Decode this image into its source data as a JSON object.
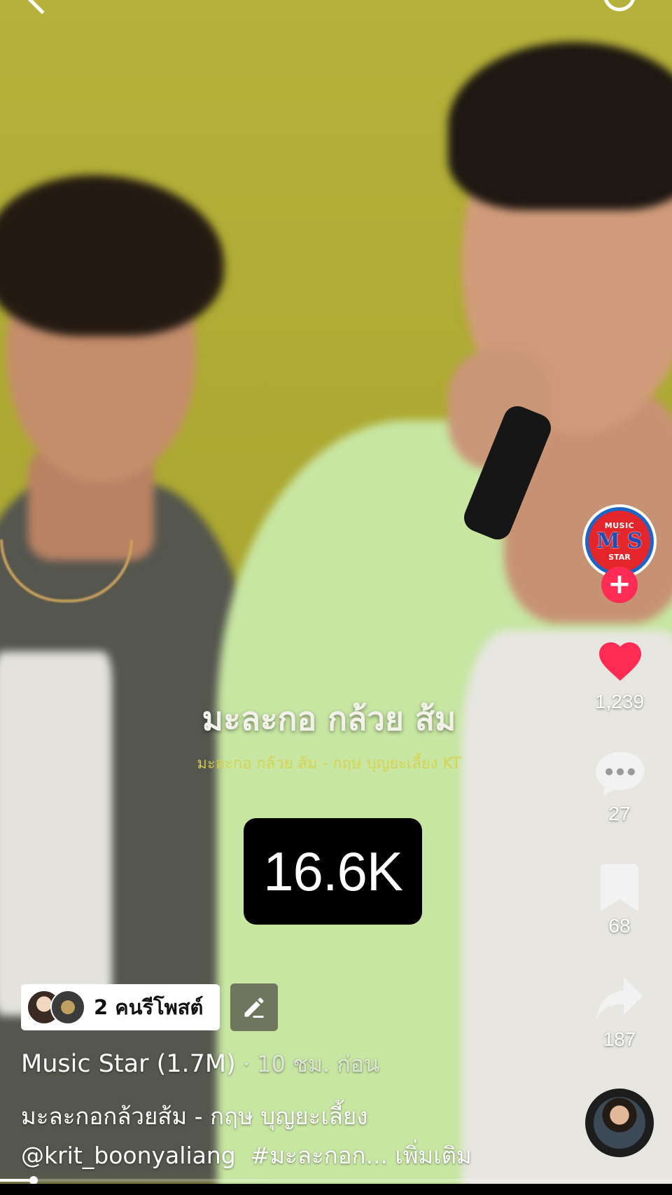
{
  "video": {
    "lyric_main": "มะละกอ กล้วย ส้ม",
    "lyric_sub": "มะละกอ กล้วย ส้ม - กฤษ บุญยะเลี้ยง KT",
    "views_badge": "16.6K",
    "progress_fraction": 0.05
  },
  "creator_avatar": {
    "top_text": "MUSIC",
    "mid_text": "M S",
    "bottom_text": "STAR",
    "follow_label": "+"
  },
  "actions": {
    "likes": "1,239",
    "comments": "27",
    "saves": "68",
    "shares": "187"
  },
  "repost": {
    "label": "2 คนรีโพสต์"
  },
  "post": {
    "author": "Music Star (1.7M)",
    "time": " · 10 ชม. ก่อน",
    "caption_line1": "มะละกอกล้วยส้ม - กฤษ บุญยะเลี้ยง",
    "mention": "@krit_boonyaliang",
    "hashtag": "#มะละกอก...",
    "more_label": "เพิ่มเติม"
  },
  "icons": {
    "back": "chevron-left-icon",
    "search": "search-icon",
    "like": "heart-icon",
    "comment": "comment-icon",
    "save": "bookmark-icon",
    "share": "share-icon",
    "edit": "pencil-icon"
  },
  "colors": {
    "like": "#fe2c55",
    "follow": "#fe2c55",
    "background": "#b0ac34"
  }
}
